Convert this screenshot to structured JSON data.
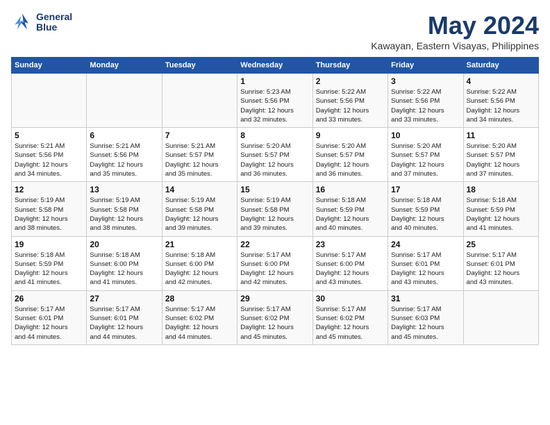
{
  "header": {
    "logo_line1": "General",
    "logo_line2": "Blue",
    "month": "May 2024",
    "location": "Kawayan, Eastern Visayas, Philippines"
  },
  "weekdays": [
    "Sunday",
    "Monday",
    "Tuesday",
    "Wednesday",
    "Thursday",
    "Friday",
    "Saturday"
  ],
  "weeks": [
    [
      {
        "day": "",
        "info": ""
      },
      {
        "day": "",
        "info": ""
      },
      {
        "day": "",
        "info": ""
      },
      {
        "day": "1",
        "info": "Sunrise: 5:23 AM\nSunset: 5:56 PM\nDaylight: 12 hours\nand 32 minutes."
      },
      {
        "day": "2",
        "info": "Sunrise: 5:22 AM\nSunset: 5:56 PM\nDaylight: 12 hours\nand 33 minutes."
      },
      {
        "day": "3",
        "info": "Sunrise: 5:22 AM\nSunset: 5:56 PM\nDaylight: 12 hours\nand 33 minutes."
      },
      {
        "day": "4",
        "info": "Sunrise: 5:22 AM\nSunset: 5:56 PM\nDaylight: 12 hours\nand 34 minutes."
      }
    ],
    [
      {
        "day": "5",
        "info": "Sunrise: 5:21 AM\nSunset: 5:56 PM\nDaylight: 12 hours\nand 34 minutes."
      },
      {
        "day": "6",
        "info": "Sunrise: 5:21 AM\nSunset: 5:56 PM\nDaylight: 12 hours\nand 35 minutes."
      },
      {
        "day": "7",
        "info": "Sunrise: 5:21 AM\nSunset: 5:57 PM\nDaylight: 12 hours\nand 35 minutes."
      },
      {
        "day": "8",
        "info": "Sunrise: 5:20 AM\nSunset: 5:57 PM\nDaylight: 12 hours\nand 36 minutes."
      },
      {
        "day": "9",
        "info": "Sunrise: 5:20 AM\nSunset: 5:57 PM\nDaylight: 12 hours\nand 36 minutes."
      },
      {
        "day": "10",
        "info": "Sunrise: 5:20 AM\nSunset: 5:57 PM\nDaylight: 12 hours\nand 37 minutes."
      },
      {
        "day": "11",
        "info": "Sunrise: 5:20 AM\nSunset: 5:57 PM\nDaylight: 12 hours\nand 37 minutes."
      }
    ],
    [
      {
        "day": "12",
        "info": "Sunrise: 5:19 AM\nSunset: 5:58 PM\nDaylight: 12 hours\nand 38 minutes."
      },
      {
        "day": "13",
        "info": "Sunrise: 5:19 AM\nSunset: 5:58 PM\nDaylight: 12 hours\nand 38 minutes."
      },
      {
        "day": "14",
        "info": "Sunrise: 5:19 AM\nSunset: 5:58 PM\nDaylight: 12 hours\nand 39 minutes."
      },
      {
        "day": "15",
        "info": "Sunrise: 5:19 AM\nSunset: 5:58 PM\nDaylight: 12 hours\nand 39 minutes."
      },
      {
        "day": "16",
        "info": "Sunrise: 5:18 AM\nSunset: 5:59 PM\nDaylight: 12 hours\nand 40 minutes."
      },
      {
        "day": "17",
        "info": "Sunrise: 5:18 AM\nSunset: 5:59 PM\nDaylight: 12 hours\nand 40 minutes."
      },
      {
        "day": "18",
        "info": "Sunrise: 5:18 AM\nSunset: 5:59 PM\nDaylight: 12 hours\nand 41 minutes."
      }
    ],
    [
      {
        "day": "19",
        "info": "Sunrise: 5:18 AM\nSunset: 5:59 PM\nDaylight: 12 hours\nand 41 minutes."
      },
      {
        "day": "20",
        "info": "Sunrise: 5:18 AM\nSunset: 6:00 PM\nDaylight: 12 hours\nand 41 minutes."
      },
      {
        "day": "21",
        "info": "Sunrise: 5:18 AM\nSunset: 6:00 PM\nDaylight: 12 hours\nand 42 minutes."
      },
      {
        "day": "22",
        "info": "Sunrise: 5:17 AM\nSunset: 6:00 PM\nDaylight: 12 hours\nand 42 minutes."
      },
      {
        "day": "23",
        "info": "Sunrise: 5:17 AM\nSunset: 6:00 PM\nDaylight: 12 hours\nand 43 minutes."
      },
      {
        "day": "24",
        "info": "Sunrise: 5:17 AM\nSunset: 6:01 PM\nDaylight: 12 hours\nand 43 minutes."
      },
      {
        "day": "25",
        "info": "Sunrise: 5:17 AM\nSunset: 6:01 PM\nDaylight: 12 hours\nand 43 minutes."
      }
    ],
    [
      {
        "day": "26",
        "info": "Sunrise: 5:17 AM\nSunset: 6:01 PM\nDaylight: 12 hours\nand 44 minutes."
      },
      {
        "day": "27",
        "info": "Sunrise: 5:17 AM\nSunset: 6:01 PM\nDaylight: 12 hours\nand 44 minutes."
      },
      {
        "day": "28",
        "info": "Sunrise: 5:17 AM\nSunset: 6:02 PM\nDaylight: 12 hours\nand 44 minutes."
      },
      {
        "day": "29",
        "info": "Sunrise: 5:17 AM\nSunset: 6:02 PM\nDaylight: 12 hours\nand 45 minutes."
      },
      {
        "day": "30",
        "info": "Sunrise: 5:17 AM\nSunset: 6:02 PM\nDaylight: 12 hours\nand 45 minutes."
      },
      {
        "day": "31",
        "info": "Sunrise: 5:17 AM\nSunset: 6:03 PM\nDaylight: 12 hours\nand 45 minutes."
      },
      {
        "day": "",
        "info": ""
      }
    ]
  ]
}
